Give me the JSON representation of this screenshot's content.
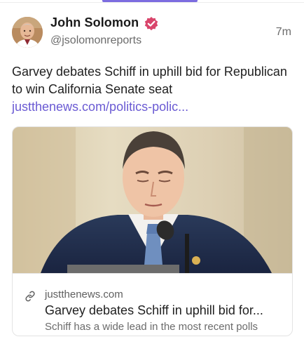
{
  "post": {
    "author": {
      "name": "John Solomon",
      "handle": "@jsolomonreports",
      "verified_color": "#d9456b"
    },
    "timestamp": "7m",
    "text": "Garvey debates Schiff in uphill bid for Republican to win California Senate seat",
    "link_text": "justthenews.com/politics-polic...",
    "link_color": "#6a5ad3",
    "card": {
      "domain": "justthenews.com",
      "title": "Garvey debates Schiff in uphill bid for...",
      "description": "Schiff has a wide lead in the most recent polls"
    }
  },
  "accent": "#7c6ce0"
}
